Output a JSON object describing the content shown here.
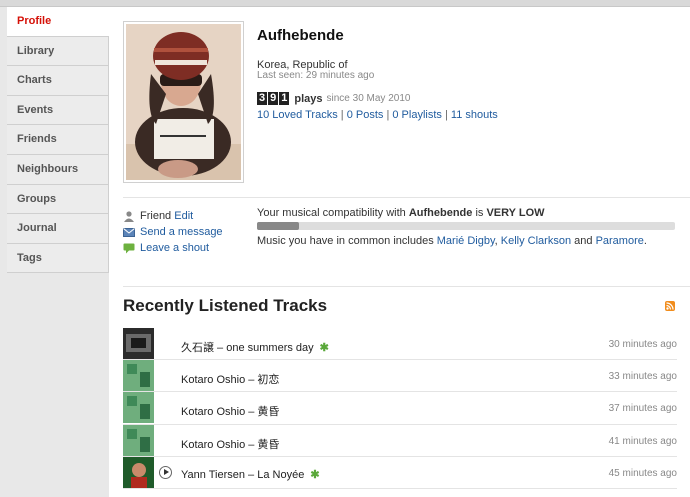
{
  "sidebar": {
    "items": [
      {
        "label": "Profile",
        "active": true
      },
      {
        "label": "Library"
      },
      {
        "label": "Charts"
      },
      {
        "label": "Events"
      },
      {
        "label": "Friends"
      },
      {
        "label": "Neighbours"
      },
      {
        "label": "Groups"
      },
      {
        "label": "Journal"
      },
      {
        "label": "Tags"
      }
    ]
  },
  "profile": {
    "username": "Aufhebende",
    "country": "Korea, Republic of",
    "last_seen": "Last seen: 29 minutes ago",
    "plays_digits": [
      "3",
      "9",
      "1"
    ],
    "plays_label": "plays",
    "since": "since 30 May 2010",
    "stats": {
      "loved": "10 Loved Tracks",
      "posts": "0 Posts",
      "playlists": "0 Playlists",
      "shouts": "11 shouts",
      "separator": "|"
    }
  },
  "actions": {
    "friend_label": "Friend",
    "edit_label": "Edit",
    "send_message": "Send a message",
    "leave_shout": "Leave a shout"
  },
  "compatibility": {
    "prefix": "Your musical compatibility with",
    "user": "Aufhebende",
    "is": "is",
    "level": "VERY LOW",
    "fraction": 0.1,
    "common_prefix": "Music you have in common includes",
    "artists": [
      "Marié Digby",
      "Kelly Clarkson",
      "Paramore"
    ],
    "comma": ",",
    "and": "and",
    "period": "."
  },
  "recent": {
    "title": "Recently Listened Tracks",
    "tracks": [
      {
        "text": "久石譲 – one summers day",
        "loved": true,
        "time": "30 minutes ago",
        "thumb": "dark"
      },
      {
        "text": "Kotaro Oshio – 初恋",
        "loved": false,
        "time": "33 minutes ago",
        "thumb": "green"
      },
      {
        "text": "Kotaro Oshio – 黄昏",
        "loved": false,
        "time": "37 minutes ago",
        "thumb": "green"
      },
      {
        "text": "Kotaro Oshio – 黄昏",
        "loved": false,
        "time": "41 minutes ago",
        "thumb": "green"
      },
      {
        "text": "Yann Tiersen – La Noyée",
        "loved": true,
        "time": "45 minutes ago",
        "thumb": "amelie",
        "playing": true
      }
    ],
    "star_glyph": "✱"
  },
  "colors": {
    "accent": "#d51007",
    "link": "#1f5b9e",
    "loved": "#5aa83a"
  }
}
